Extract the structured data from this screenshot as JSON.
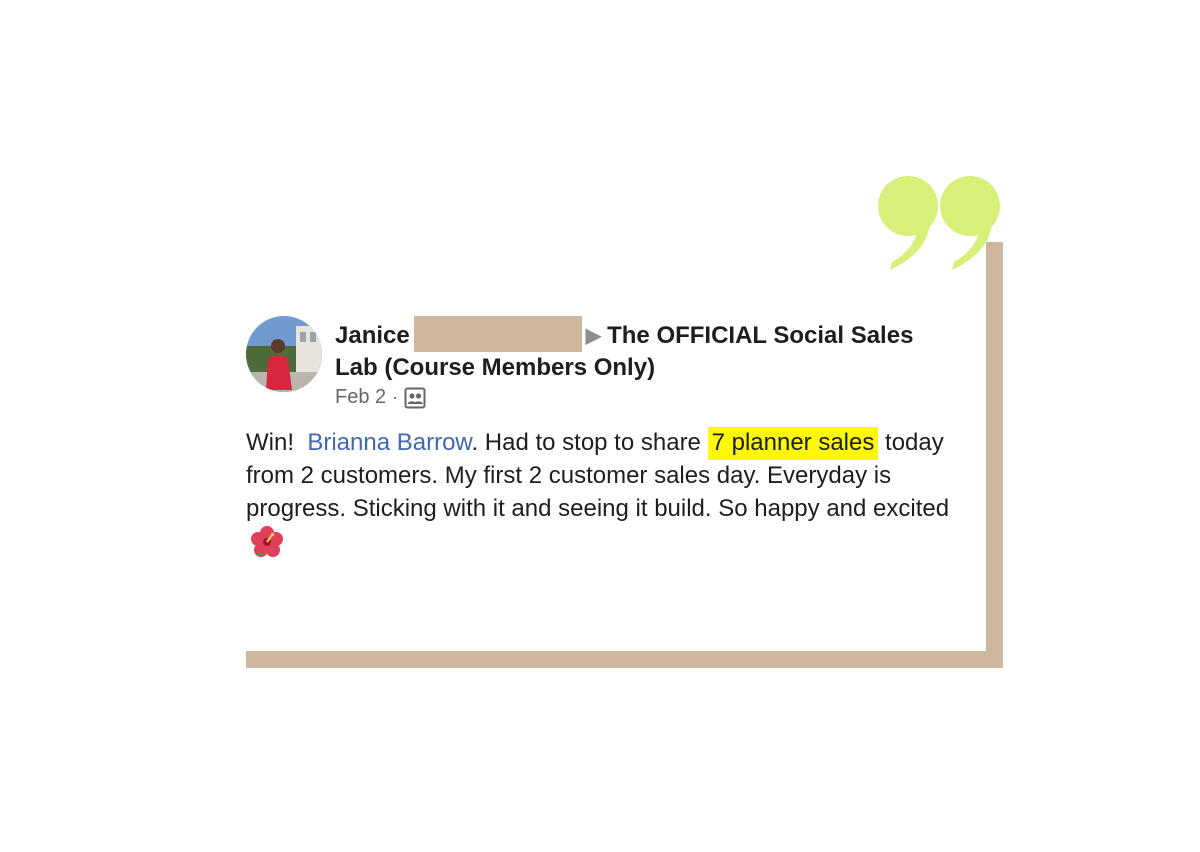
{
  "post": {
    "author_first_name": "Janice",
    "arrow_glyph": "▶",
    "group_name": "The OFFICIAL Social Sales Lab (Course Members Only)",
    "date": "Feb 2",
    "meta_separator": "·",
    "privacy_icon": "group-members-icon",
    "body": {
      "lead": "Win!",
      "mention": "Brianna Barrow",
      "after_mention": ".  Had to stop to share ",
      "highlight": "7 planner sales",
      "rest": "today from 2 customers.  My first 2 customer sales day. Everyday is progress. Sticking with it and seeing it build. So happy and excited",
      "emoji_icon": "hibiscus-icon"
    }
  },
  "decor": {
    "quote_icon": "closing-quote-icon",
    "quote_color": "#d6f07a",
    "frame_color": "#cdb89f",
    "highlight_color": "#fcf806",
    "mention_color": "#4267b2"
  }
}
